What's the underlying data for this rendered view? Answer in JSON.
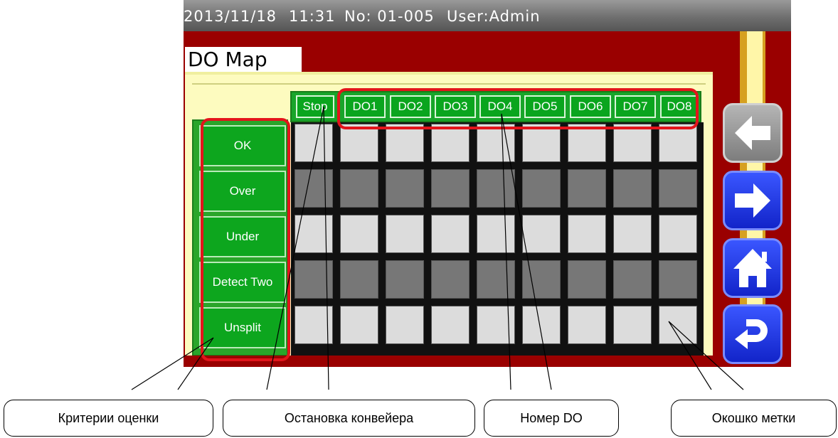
{
  "status_bar": {
    "date": "2013/11/18",
    "time": "11:31",
    "number": "No: 01-005",
    "user": "User:Admin"
  },
  "title": "DO Map",
  "columns": [
    "Stop",
    "DO1",
    "DO2",
    "DO3",
    "DO4",
    "DO5",
    "DO6",
    "DO7",
    "DO8"
  ],
  "rows": [
    {
      "label": "OK",
      "shade": "light"
    },
    {
      "label": "Over",
      "shade": "dark"
    },
    {
      "label": "Under",
      "shade": "light"
    },
    {
      "label": "Detect Two",
      "shade": "dark"
    },
    {
      "label": "Unsplit",
      "shade": "light"
    }
  ],
  "nav_buttons": [
    "arrow-left-icon",
    "arrow-right-icon",
    "home-icon",
    "return-icon"
  ],
  "callouts": {
    "criteria": "Критерии оценки",
    "conveyor_stop": "Остановка конвейера",
    "do_number": "Номер DO",
    "mark_window": "Окошко метки"
  },
  "colors": {
    "background": "#9a0000",
    "panel": "#fdfbbf",
    "label_green": "#0da61e",
    "cell_light": "#dcdcdc",
    "cell_dark": "#777777",
    "nav_blue": "#1a32e6",
    "highlight": "#e3141b"
  }
}
